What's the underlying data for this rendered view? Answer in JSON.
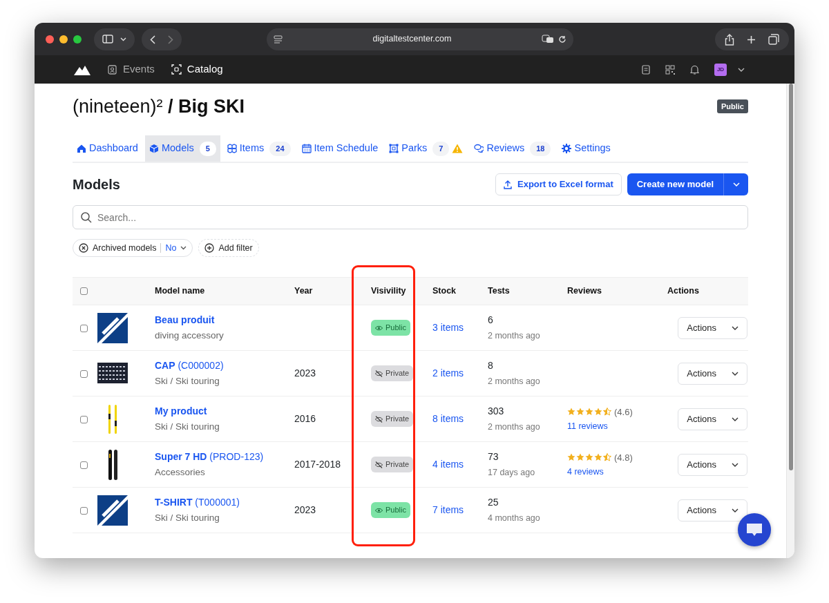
{
  "browser": {
    "url": "digitaltestcenter.com"
  },
  "app_nav": {
    "items": [
      {
        "label": "Events",
        "selected": false
      },
      {
        "label": "Catalog",
        "selected": true
      }
    ],
    "avatar": "JD"
  },
  "header": {
    "title": "(nineteen)² **/ Big SKI**",
    "badge": "Public"
  },
  "tabs": [
    {
      "label": "Dashboard",
      "selected": false
    },
    {
      "label": "Models",
      "count": "5",
      "selected": true
    },
    {
      "label": "Items",
      "count": "24",
      "selected": false
    },
    {
      "label": "Item Schedule",
      "selected": false
    },
    {
      "label": "Parks",
      "count": "7",
      "warning": true,
      "selected": false
    },
    {
      "label": "Reviews",
      "count": "18",
      "selected": false
    },
    {
      "label": "Settings",
      "selected": false
    }
  ],
  "section": {
    "title": "Models",
    "export_button": "Export to Excel format",
    "create_button": "Create new model"
  },
  "search": {
    "placeholder": "Search..."
  },
  "filters": [
    {
      "label": "Archived models",
      "value": "No"
    }
  ],
  "add_filter": "Add filter",
  "table": {
    "select_all": {
      "checked": false
    },
    "columns": [
      {
        "label": "Model name"
      },
      {
        "label": "Year"
      },
      {
        "label": "Visivility",
        "highlighted": true
      },
      {
        "label": "Stock"
      },
      {
        "label": "Tests"
      },
      {
        "label": "Reviews"
      },
      {
        "label": "Actions"
      }
    ],
    "rows": [
      {
        "checked": false,
        "name": "Beau produit",
        "category": "diving accessory",
        "visibility": {
          "kind": "public",
          "label": "Public"
        },
        "stock": "3 items",
        "tests": "6",
        "tests_when": "2 months ago",
        "action": "Actions"
      },
      {
        "checked": false,
        "name": "CAP",
        "code": "(C000002)",
        "category": "Ski / Ski touring",
        "year": "2023",
        "visibility": {
          "kind": "private",
          "label": "Private"
        },
        "stock": "2 items",
        "tests": "8",
        "tests_when": "2 months ago",
        "action": "Actions"
      },
      {
        "checked": false,
        "name": "My product",
        "category": "Ski / Ski touring",
        "year": "2016",
        "visibility": {
          "kind": "private",
          "label": "Private"
        },
        "stock": "8 items",
        "tests": "303",
        "tests_when": "2 months ago",
        "reviews": {
          "stars": 4.5,
          "rating": "(4.6)",
          "count": "11 reviews"
        },
        "action": "Actions"
      },
      {
        "checked": false,
        "name": "Super 7 HD",
        "code": "(PROD-123)",
        "category": "Accessories",
        "year": "2017-2018",
        "visibility": {
          "kind": "private",
          "label": "Private"
        },
        "stock": "4 items",
        "tests": "73",
        "tests_when": "17 days ago",
        "reviews": {
          "stars": 4.5,
          "rating": "(4.8)",
          "count": "4 reviews"
        },
        "action": "Actions"
      },
      {
        "checked": false,
        "name": "T-SHIRT",
        "code": "(T000001)",
        "category": "Ski / Ski touring",
        "year": "2023",
        "visibility": {
          "kind": "public",
          "label": "Public"
        },
        "stock": "7 items",
        "tests": "25",
        "tests_when": "4 months ago",
        "action": "Actions"
      }
    ]
  }
}
